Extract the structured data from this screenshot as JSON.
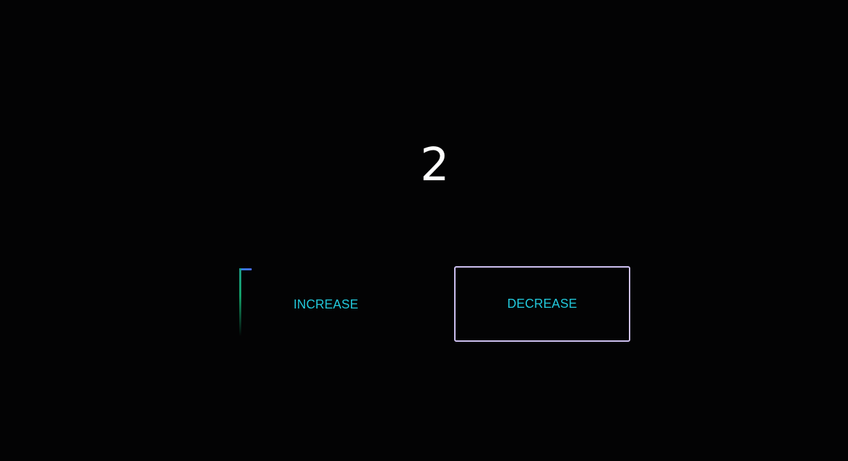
{
  "counter": {
    "value": "2"
  },
  "buttons": {
    "increase_label": "INCREASE",
    "decrease_label": "DECREASE"
  },
  "colors": {
    "background": "#030304",
    "counter_text": "#ffffff",
    "button_text": "#22c9dc",
    "decrease_border": "#d3c6f8",
    "increase_trace_top": "#3f74e8",
    "increase_trace_side": "#13a06a"
  }
}
